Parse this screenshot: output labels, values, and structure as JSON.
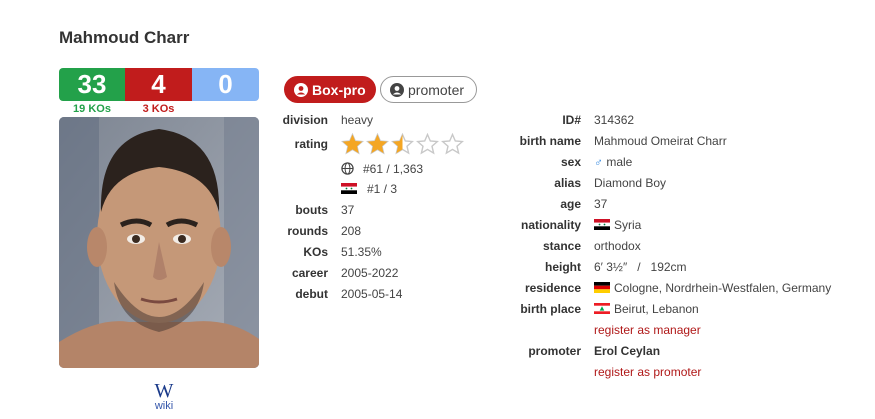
{
  "boxer": {
    "name": "Mahmoud Charr"
  },
  "record": {
    "wins": "33",
    "losses": "4",
    "draws": "0",
    "wins_kos": "19 KOs",
    "losses_kos": "3 KOs"
  },
  "badges": {
    "boxpro": "Box-pro",
    "promoter": "promoter"
  },
  "wiki": {
    "glyph": "W",
    "label": "wiki"
  },
  "left": {
    "division_label": "division",
    "division": "heavy",
    "rating_label": "rating",
    "rating_stars": 2.5,
    "rating_max": 5,
    "world_rank": "#61 / 1,363",
    "country_rank": "#1 / 3",
    "bouts_label": "bouts",
    "bouts": "37",
    "rounds_label": "rounds",
    "rounds": "208",
    "kos_label": "KOs",
    "kos": "51.35%",
    "career_label": "career",
    "career": "2005-2022",
    "debut_label": "debut",
    "debut": "2005-05-14"
  },
  "right": {
    "id_label": "ID#",
    "id": "314362",
    "birthname_label": "birth name",
    "birthname": "Mahmoud Omeirat Charr",
    "sex_label": "sex",
    "sex_symbol": "♂",
    "sex": "male",
    "alias_label": "alias",
    "alias": "Diamond Boy",
    "age_label": "age",
    "age": "37",
    "nationality_label": "nationality",
    "nationality": "Syria",
    "stance_label": "stance",
    "stance": "orthodox",
    "height_label": "height",
    "height": "6′ 3½″   /   192cm",
    "residence_label": "residence",
    "residence": "Cologne, Nordrhein-Westfalen, Germany",
    "birthplace_label": "birth place",
    "birthplace": "Beirut, Lebanon",
    "register_manager": "register as manager",
    "promoter_label": "promoter",
    "promoter": "Erol Ceylan",
    "register_promoter": "register as promoter"
  },
  "colors": {
    "win": "#23a14a",
    "loss": "#c11c1c",
    "draw": "#86b5f5",
    "star": "#f4a623"
  }
}
